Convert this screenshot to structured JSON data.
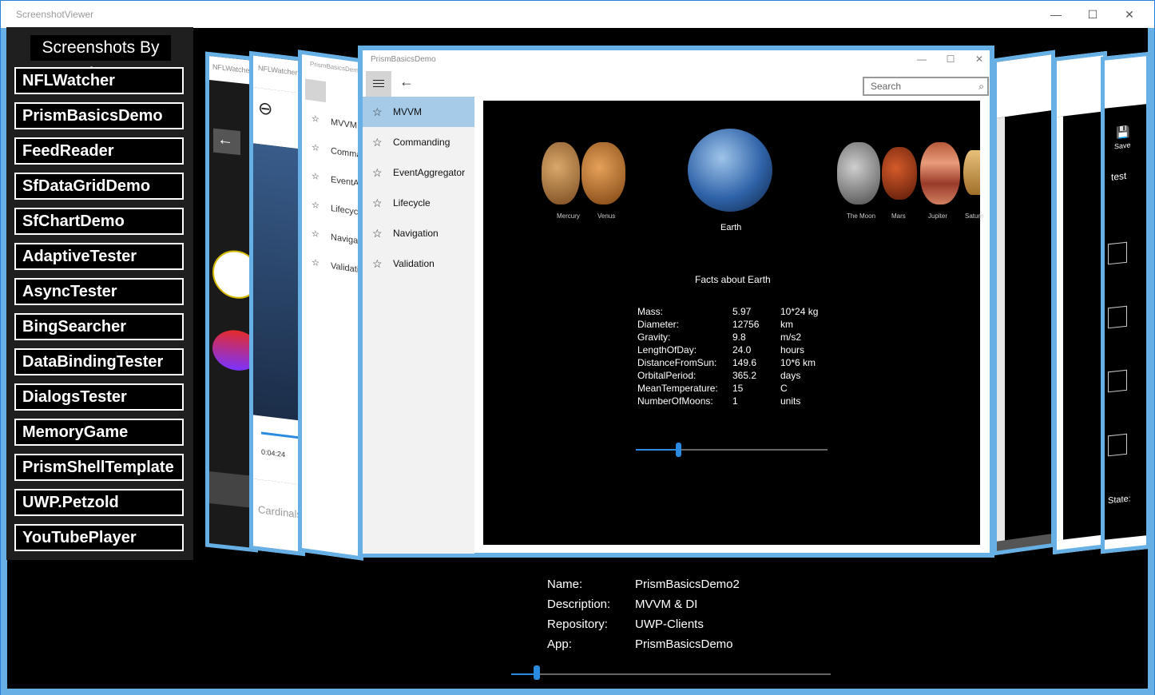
{
  "window": {
    "title": "ScreenshotViewer",
    "minimize": "—",
    "maximize": "☐",
    "close": "✕"
  },
  "sidebar": {
    "title": "Screenshots By App",
    "apps": [
      "NFLWatcher",
      "PrismBasicsDemo",
      "FeedReader",
      "SfDataGridDemo",
      "SfChartDemo",
      "AdaptiveTester",
      "AsyncTester",
      "BingSearcher",
      "DataBindingTester",
      "DialogsTester",
      "MemoryGame",
      "PrismShellTemplate",
      "UWP.Petzold",
      "YouTubePlayer"
    ]
  },
  "carousel": {
    "left_cards": [
      {
        "title": "NFLWatcher"
      },
      {
        "title": "NFLWatcher",
        "time": "0:04:24",
        "footer": "Cardinals"
      },
      {
        "title": "PrismBasicsDemo",
        "items": [
          "MVVM",
          "Comma",
          "EventAg",
          "Lifecycl",
          "Navigat",
          "Validati"
        ]
      }
    ],
    "right_cards": [
      {
        "title": ""
      },
      {
        "title": ""
      },
      {
        "save_label": "Save",
        "text1": "test",
        "state_label": "State:"
      }
    ]
  },
  "main_card": {
    "title": "PrismBasicsDemo",
    "search_placeholder": "Search",
    "nav_items": [
      {
        "label": "MVVM",
        "selected": true
      },
      {
        "label": "Commanding",
        "selected": false
      },
      {
        "label": "EventAggregator",
        "selected": false
      },
      {
        "label": "Lifecycle",
        "selected": false
      },
      {
        "label": "Navigation",
        "selected": false
      },
      {
        "label": "Validation",
        "selected": false
      }
    ],
    "planets": {
      "left": [
        "Mercury",
        "Venus"
      ],
      "center": "Earth",
      "right": [
        "The Moon",
        "Mars",
        "Jupiter",
        "Saturn"
      ]
    },
    "facts_title": "Facts about Earth",
    "facts": [
      {
        "key": "Mass:",
        "value": "5.97",
        "unit": "10*24 kg"
      },
      {
        "key": "Diameter:",
        "value": "12756",
        "unit": "km"
      },
      {
        "key": "Gravity:",
        "value": "9.8",
        "unit": "m/s2"
      },
      {
        "key": "LengthOfDay:",
        "value": "24.0",
        "unit": "hours"
      },
      {
        "key": "DistanceFromSun:",
        "value": "149.6",
        "unit": "10*6 km"
      },
      {
        "key": "OrbitalPeriod:",
        "value": "365.2",
        "unit": "days"
      },
      {
        "key": "MeanTemperature:",
        "value": "15",
        "unit": "C"
      },
      {
        "key": "NumberOfMoons:",
        "value": "1",
        "unit": "units"
      }
    ],
    "slider_value": 0.22
  },
  "details": {
    "name_label": "Name:",
    "name": "PrismBasicsDemo2",
    "description_label": "Description:",
    "description": "MVVM & DI",
    "repository_label": "Repository:",
    "repository": "UWP-Clients",
    "app_label": "App:",
    "app": "PrismBasicsDemo"
  },
  "carousel_slider_value": 0.08,
  "colors": {
    "accent": "#66b0e6",
    "selected": "#a6cbe8",
    "slider": "#2a8be0"
  }
}
